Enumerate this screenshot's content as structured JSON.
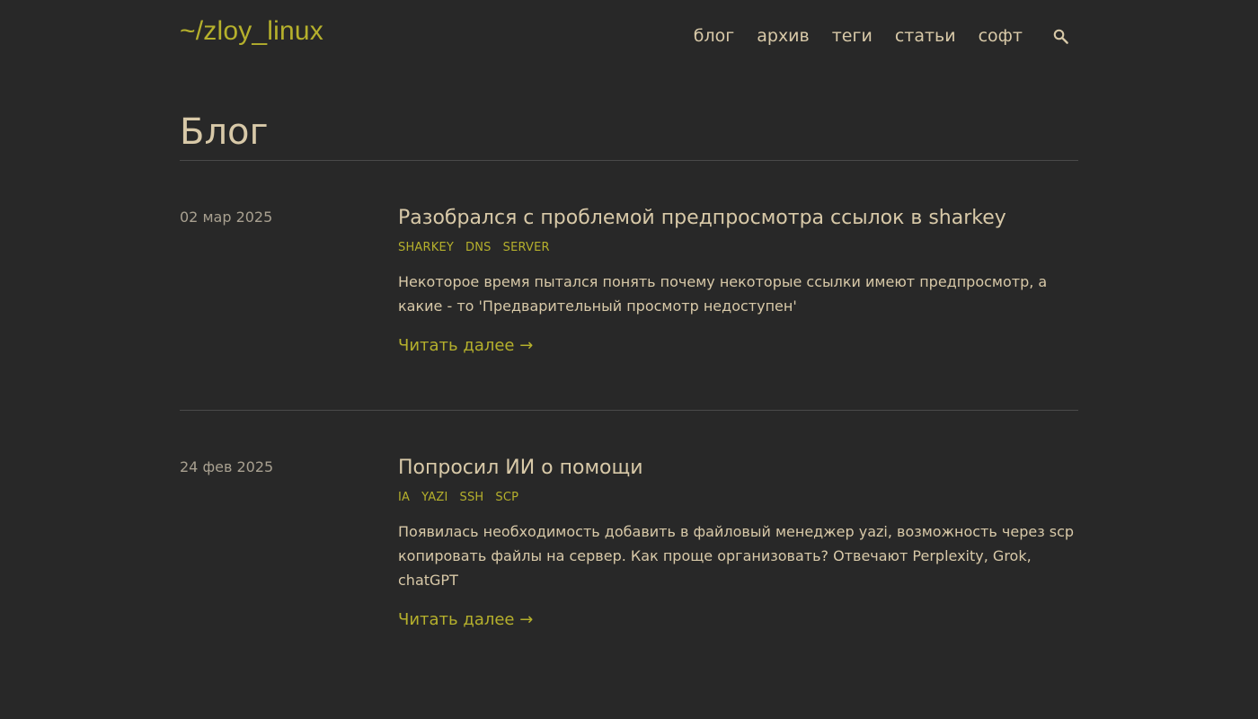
{
  "site": {
    "logo": "~/zloy_linux"
  },
  "nav": {
    "items": [
      "блог",
      "архив",
      "теги",
      "статьи",
      "софт"
    ]
  },
  "page": {
    "title": "Блог"
  },
  "posts": [
    {
      "date": "02 мар 2025",
      "title": "Разобрался с проблемой предпросмотра ссылок в sharkey",
      "tags": [
        "SHARKEY",
        "DNS",
        "SERVER"
      ],
      "excerpt": "Некоторое время пытался понять почему некоторые ссылки имеют предпросмотр, а какие - то 'Предварительный просмотр недоступен'",
      "read_more": "Читать далее →"
    },
    {
      "date": "24 фев 2025",
      "title": "Попросил ИИ о помощи",
      "tags": [
        "IA",
        "YAZI",
        "SSH",
        "SCP"
      ],
      "excerpt": "Появилась необходимость добавить в файловый менеджер yazi, возможность через scp копировать файлы на сервер. Как проще организовать? Отвечают Perplexity, Grok, chatGPT",
      "read_more": "Читать далее →"
    }
  ],
  "colors": {
    "background": "#282828",
    "accent": "#b5b02c",
    "text": "#d8c9a8"
  },
  "icons": {
    "search": "search-icon"
  }
}
